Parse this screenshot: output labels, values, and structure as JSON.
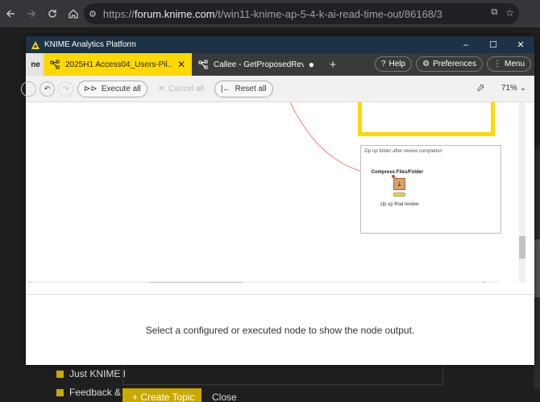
{
  "browser": {
    "url_prefix": "https://",
    "url_domain": "forum.knime.com",
    "url_path": "/t/win11-knime-ap-5-4-k-ai-read-time-out/86168/3"
  },
  "forum": {
    "items": [
      "Just KNIME I",
      "Feedback & I"
    ],
    "create_topic": "+ Create Topic",
    "close": "Close"
  },
  "window": {
    "title": "KNIME Analytics Platform",
    "controls": [
      "–",
      "☐",
      "✕"
    ]
  },
  "tabs": {
    "stub": "ne",
    "active_label": "2025H1 Access04_Users-Pil...",
    "inactive_label": "Callee - GetProposedReview...",
    "add": "+",
    "help": "Help",
    "preferences": "Preferences",
    "menu": "Menu"
  },
  "toolbar": {
    "execute_all": "Execute all",
    "cancel_all": "Cancel all",
    "reset_all": "Reset all",
    "zoom": "71%"
  },
  "canvas": {
    "annotation_title": "Zip up folder after review completion",
    "node_name": "Compress Files/Folder",
    "node_description": "zip up final review"
  },
  "output": {
    "message": "Select a configured or executed node to show the node output."
  },
  "colors": {
    "accent": "#ffd800",
    "titlebar": "#1d3244"
  }
}
